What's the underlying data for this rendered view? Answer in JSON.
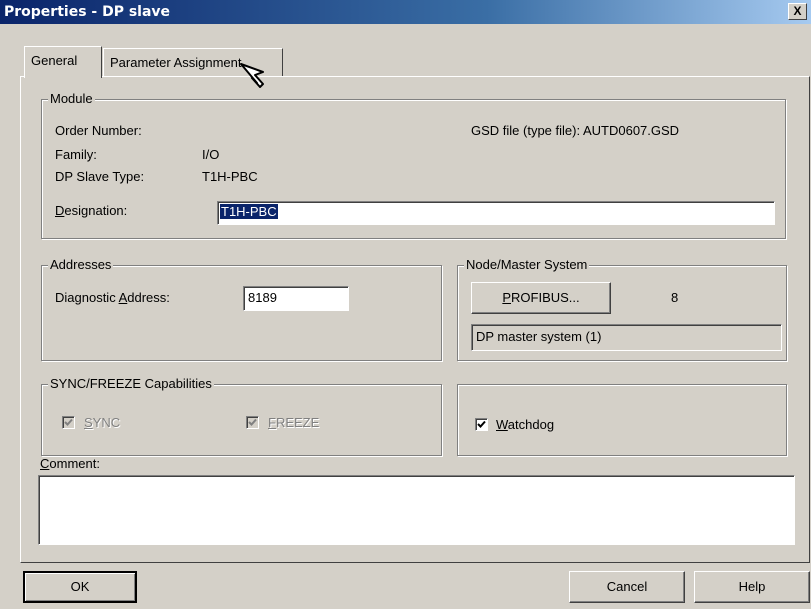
{
  "window": {
    "title": "Properties - DP slave",
    "close_glyph": "X"
  },
  "tabs": [
    {
      "label": "General",
      "active": true
    },
    {
      "label": "Parameter Assignment",
      "active": false
    }
  ],
  "module": {
    "legend": "Module",
    "order_number_label": "Order Number:",
    "order_number_value": "",
    "gsd_text": "GSD file (type file): AUTD0607.GSD",
    "family_label": "Family:",
    "family_value": "I/O",
    "slave_type_label": "DP Slave Type:",
    "slave_type_value": "T1H-PBC",
    "designation_label_first": "D",
    "designation_label_rest": "esignation:",
    "designation_value": "T1H-PBC"
  },
  "addresses": {
    "legend": "Addresses",
    "diag_label_pre": "Diagnostic ",
    "diag_label_u": "A",
    "diag_label_post": "ddress:",
    "diag_value": "8189"
  },
  "node": {
    "legend": "Node/Master System",
    "profibus_u": "P",
    "profibus_rest": "ROFIBUS...",
    "node_number": "8",
    "master_system": "DP master system (1)"
  },
  "syncfreeze": {
    "legend": "SYNC/FREEZE Capabilities",
    "sync_u": "S",
    "sync_rest": "YNC",
    "sync_checked": true,
    "freeze_u": "F",
    "freeze_rest": "REEZE",
    "freeze_checked": true
  },
  "watchdog": {
    "u": "W",
    "rest": "atchdog",
    "checked": true
  },
  "comment": {
    "label_u": "C",
    "label_rest": "omment:",
    "value": ""
  },
  "buttons": {
    "ok": "OK",
    "cancel": "Cancel",
    "help": "Help"
  },
  "colors": {
    "face": "#d4d0c8",
    "title_start": "#0a246a",
    "title_end": "#a6caf0",
    "selection": "#0a246a"
  }
}
